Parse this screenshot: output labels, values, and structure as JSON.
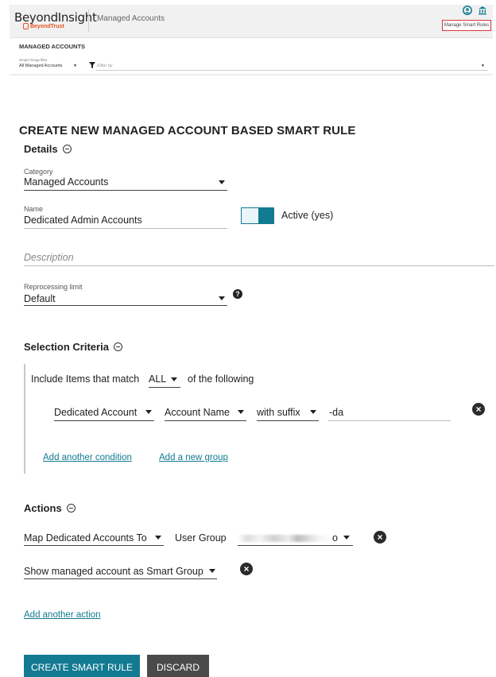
{
  "header": {
    "brand": "BeyondInsight",
    "brand_sub": "BeyondTrust",
    "breadcrumb": "Managed Accounts",
    "manage_smart_rules": "Manage Smart Rules",
    "icons": [
      "user-icon",
      "bank-icon"
    ],
    "accent_color": "#127a91"
  },
  "subheader": {
    "title": "MANAGED ACCOUNTS",
    "filter_label": "Smart Group filter",
    "filter_value": "All Managed Accounts",
    "filter_placeholder": "Filter by"
  },
  "form": {
    "title": "CREATE NEW MANAGED ACCOUNT BASED SMART RULE",
    "details": {
      "heading": "Details",
      "category_label": "Category",
      "category_value": "Managed Accounts",
      "name_label": "Name",
      "name_value": "Dedicated Admin Accounts",
      "active_label": "Active (yes)",
      "active": true,
      "description_placeholder": "Description",
      "reprocessing_label": "Reprocessing limit",
      "reprocessing_value": "Default"
    },
    "selection": {
      "heading": "Selection Criteria",
      "include_prefix": "Include Items that match",
      "match_value": "ALL",
      "include_suffix": "of the following",
      "condition": {
        "type": "Dedicated Account",
        "field": "Account Name",
        "operator": "with suffix",
        "value": "-da"
      },
      "add_condition": "Add another condition",
      "add_group": "Add a new group"
    },
    "actions": {
      "heading": "Actions",
      "action1": {
        "type": "Map Dedicated Accounts To",
        "target_label": "User Group",
        "target_value_suffix": "o"
      },
      "action2": {
        "type": "Show managed account as Smart Group"
      },
      "add_action": "Add another action"
    },
    "buttons": {
      "create": "CREATE SMART RULE",
      "discard": "DISCARD"
    }
  }
}
